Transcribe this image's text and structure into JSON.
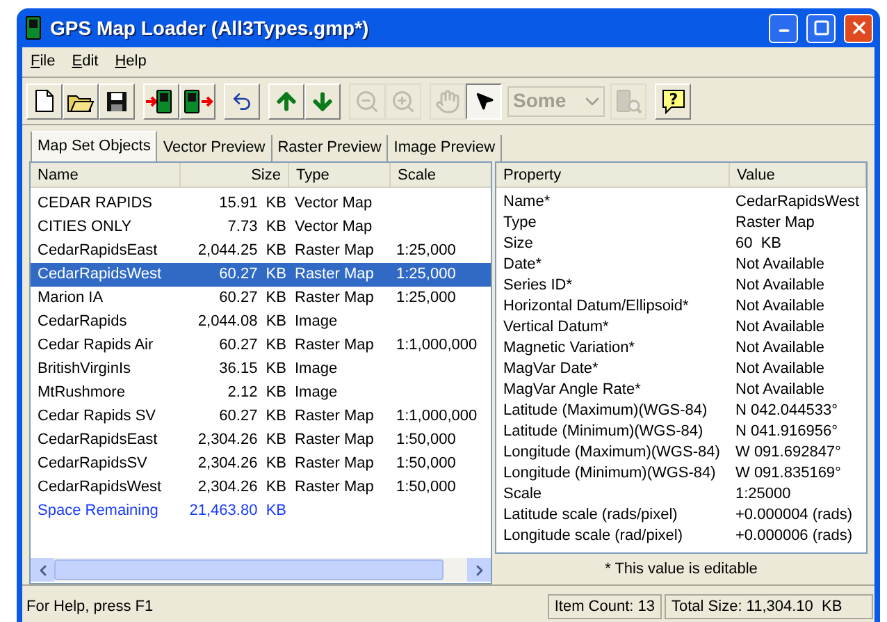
{
  "window": {
    "title": "GPS Map Loader (All3Types.gmp*)"
  },
  "menu": [
    {
      "label": "File"
    },
    {
      "label": "Edit"
    },
    {
      "label": "Help"
    }
  ],
  "toolbar": [
    [
      {
        "kind": "new",
        "disabled": false
      },
      {
        "kind": "open",
        "disabled": false
      },
      {
        "kind": "save",
        "disabled": false
      }
    ],
    [
      {
        "kind": "send",
        "disabled": false
      },
      {
        "kind": "receive",
        "disabled": false
      }
    ],
    [
      {
        "kind": "undo",
        "disabled": false
      }
    ],
    [
      {
        "kind": "up",
        "disabled": false
      },
      {
        "kind": "down",
        "disabled": false
      }
    ],
    [
      {
        "kind": "zoom-out",
        "disabled": true
      },
      {
        "kind": "zoom-in",
        "disabled": true
      }
    ],
    [
      {
        "kind": "hand",
        "disabled": true,
        "selected": false
      },
      {
        "kind": "pointer",
        "disabled": false,
        "selected": true
      },
      {
        "kind": "combo",
        "value": "Some",
        "disabled": true
      },
      {
        "kind": "find",
        "disabled": true
      }
    ],
    [
      {
        "kind": "help",
        "glyph": "?",
        "disabled": false
      }
    ]
  ],
  "tabs": [
    {
      "label": "Map Set Objects",
      "selected": true
    },
    {
      "label": "Vector Preview",
      "selected": false
    },
    {
      "label": "Raster Preview",
      "selected": false
    },
    {
      "label": "Image Preview",
      "selected": false
    }
  ],
  "table": {
    "columns": [
      "Name",
      "Size",
      "Type",
      "Scale"
    ],
    "rows": [
      {
        "name": "CEDAR RAPIDS",
        "size": "15.91  KB",
        "type": "Vector Map",
        "selected": false
      },
      {
        "name": "CITIES ONLY",
        "size": "7.73  KB",
        "type": "Vector Map",
        "selected": false
      },
      {
        "name": "CedarRapidsEast",
        "size": "2,044.25  KB",
        "type": "Raster Map",
        "scale": "1:25,000",
        "selected": false
      },
      {
        "name": "CedarRapidsWest",
        "size": "60.27  KB",
        "type": "Raster Map",
        "scale": "1:25,000",
        "selected": true
      },
      {
        "name": "Marion IA",
        "size": "60.27  KB",
        "type": "Raster Map",
        "scale": "1:25,000",
        "selected": false
      },
      {
        "name": "CedarRapids",
        "size": "2,044.08  KB",
        "type": "Image",
        "selected": false
      },
      {
        "name": "Cedar Rapids Air",
        "size": "60.27  KB",
        "type": "Raster Map",
        "scale": "1:1,000,000",
        "selected": false
      },
      {
        "name": "BritishVirginIs",
        "size": "36.15  KB",
        "type": "Image",
        "selected": false
      },
      {
        "name": "MtRushmore",
        "size": "2.12  KB",
        "type": "Image",
        "selected": false
      },
      {
        "name": "Cedar Rapids SV",
        "size": "60.27  KB",
        "type": "Raster Map",
        "scale": "1:1,000,000",
        "selected": false
      },
      {
        "name": "CedarRapidsEast",
        "size": "2,304.26  KB",
        "type": "Raster Map",
        "scale": "1:50,000",
        "selected": false
      },
      {
        "name": "CedarRapidsSV",
        "size": "2,304.26  KB",
        "type": "Raster Map",
        "scale": "1:50,000",
        "selected": false
      },
      {
        "name": "CedarRapidsWest",
        "size": "2,304.26  KB",
        "type": "Raster Map",
        "scale": "1:50,000",
        "selected": false
      },
      {
        "kind": "remaining",
        "name": "Space Remaining",
        "size": "21,463.80  KB",
        "selected": false
      }
    ]
  },
  "properties": {
    "columns": [
      "Property",
      "Value"
    ],
    "rows": [
      {
        "property": "Name*",
        "value": "CedarRapidsWest"
      },
      {
        "property": "Type",
        "value": "Raster Map"
      },
      {
        "property": "Size",
        "value": "60  KB"
      },
      {
        "property": "Date*",
        "value": "Not Available"
      },
      {
        "property": "Series ID*",
        "value": "Not Available"
      },
      {
        "property": "Horizontal Datum/Ellipsoid*",
        "value": "Not Available"
      },
      {
        "property": "Vertical Datum*",
        "value": "Not Available"
      },
      {
        "property": "Magnetic Variation*",
        "value": "Not Available"
      },
      {
        "property": "MagVar Date*",
        "value": "Not Available"
      },
      {
        "property": "MagVar Angle Rate*",
        "value": "Not Available"
      },
      {
        "property": "Latitude (Maximum)(WGS-84)",
        "value": "N 042.044533°"
      },
      {
        "property": "Latitude (Minimum)(WGS-84)",
        "value": "N 041.916956°"
      },
      {
        "property": "Longitude (Maximum)(WGS-84)",
        "value": "W 091.692847°"
      },
      {
        "property": "Longitude (Minimum)(WGS-84)",
        "value": "W 091.835169°"
      },
      {
        "property": "Scale",
        "value": "1:25000"
      },
      {
        "property": "Latitude scale (rads/pixel)",
        "value": "+0.000004 (rads)"
      },
      {
        "property": "Longitude scale (rad/pixel)",
        "value": "+0.000006 (rads)"
      }
    ],
    "note": "* This value is editable"
  },
  "status_bar": {
    "help": "For Help, press F1",
    "item_count": "Item Count: 13",
    "total_size": "Total Size: 11,304.10  KB"
  }
}
